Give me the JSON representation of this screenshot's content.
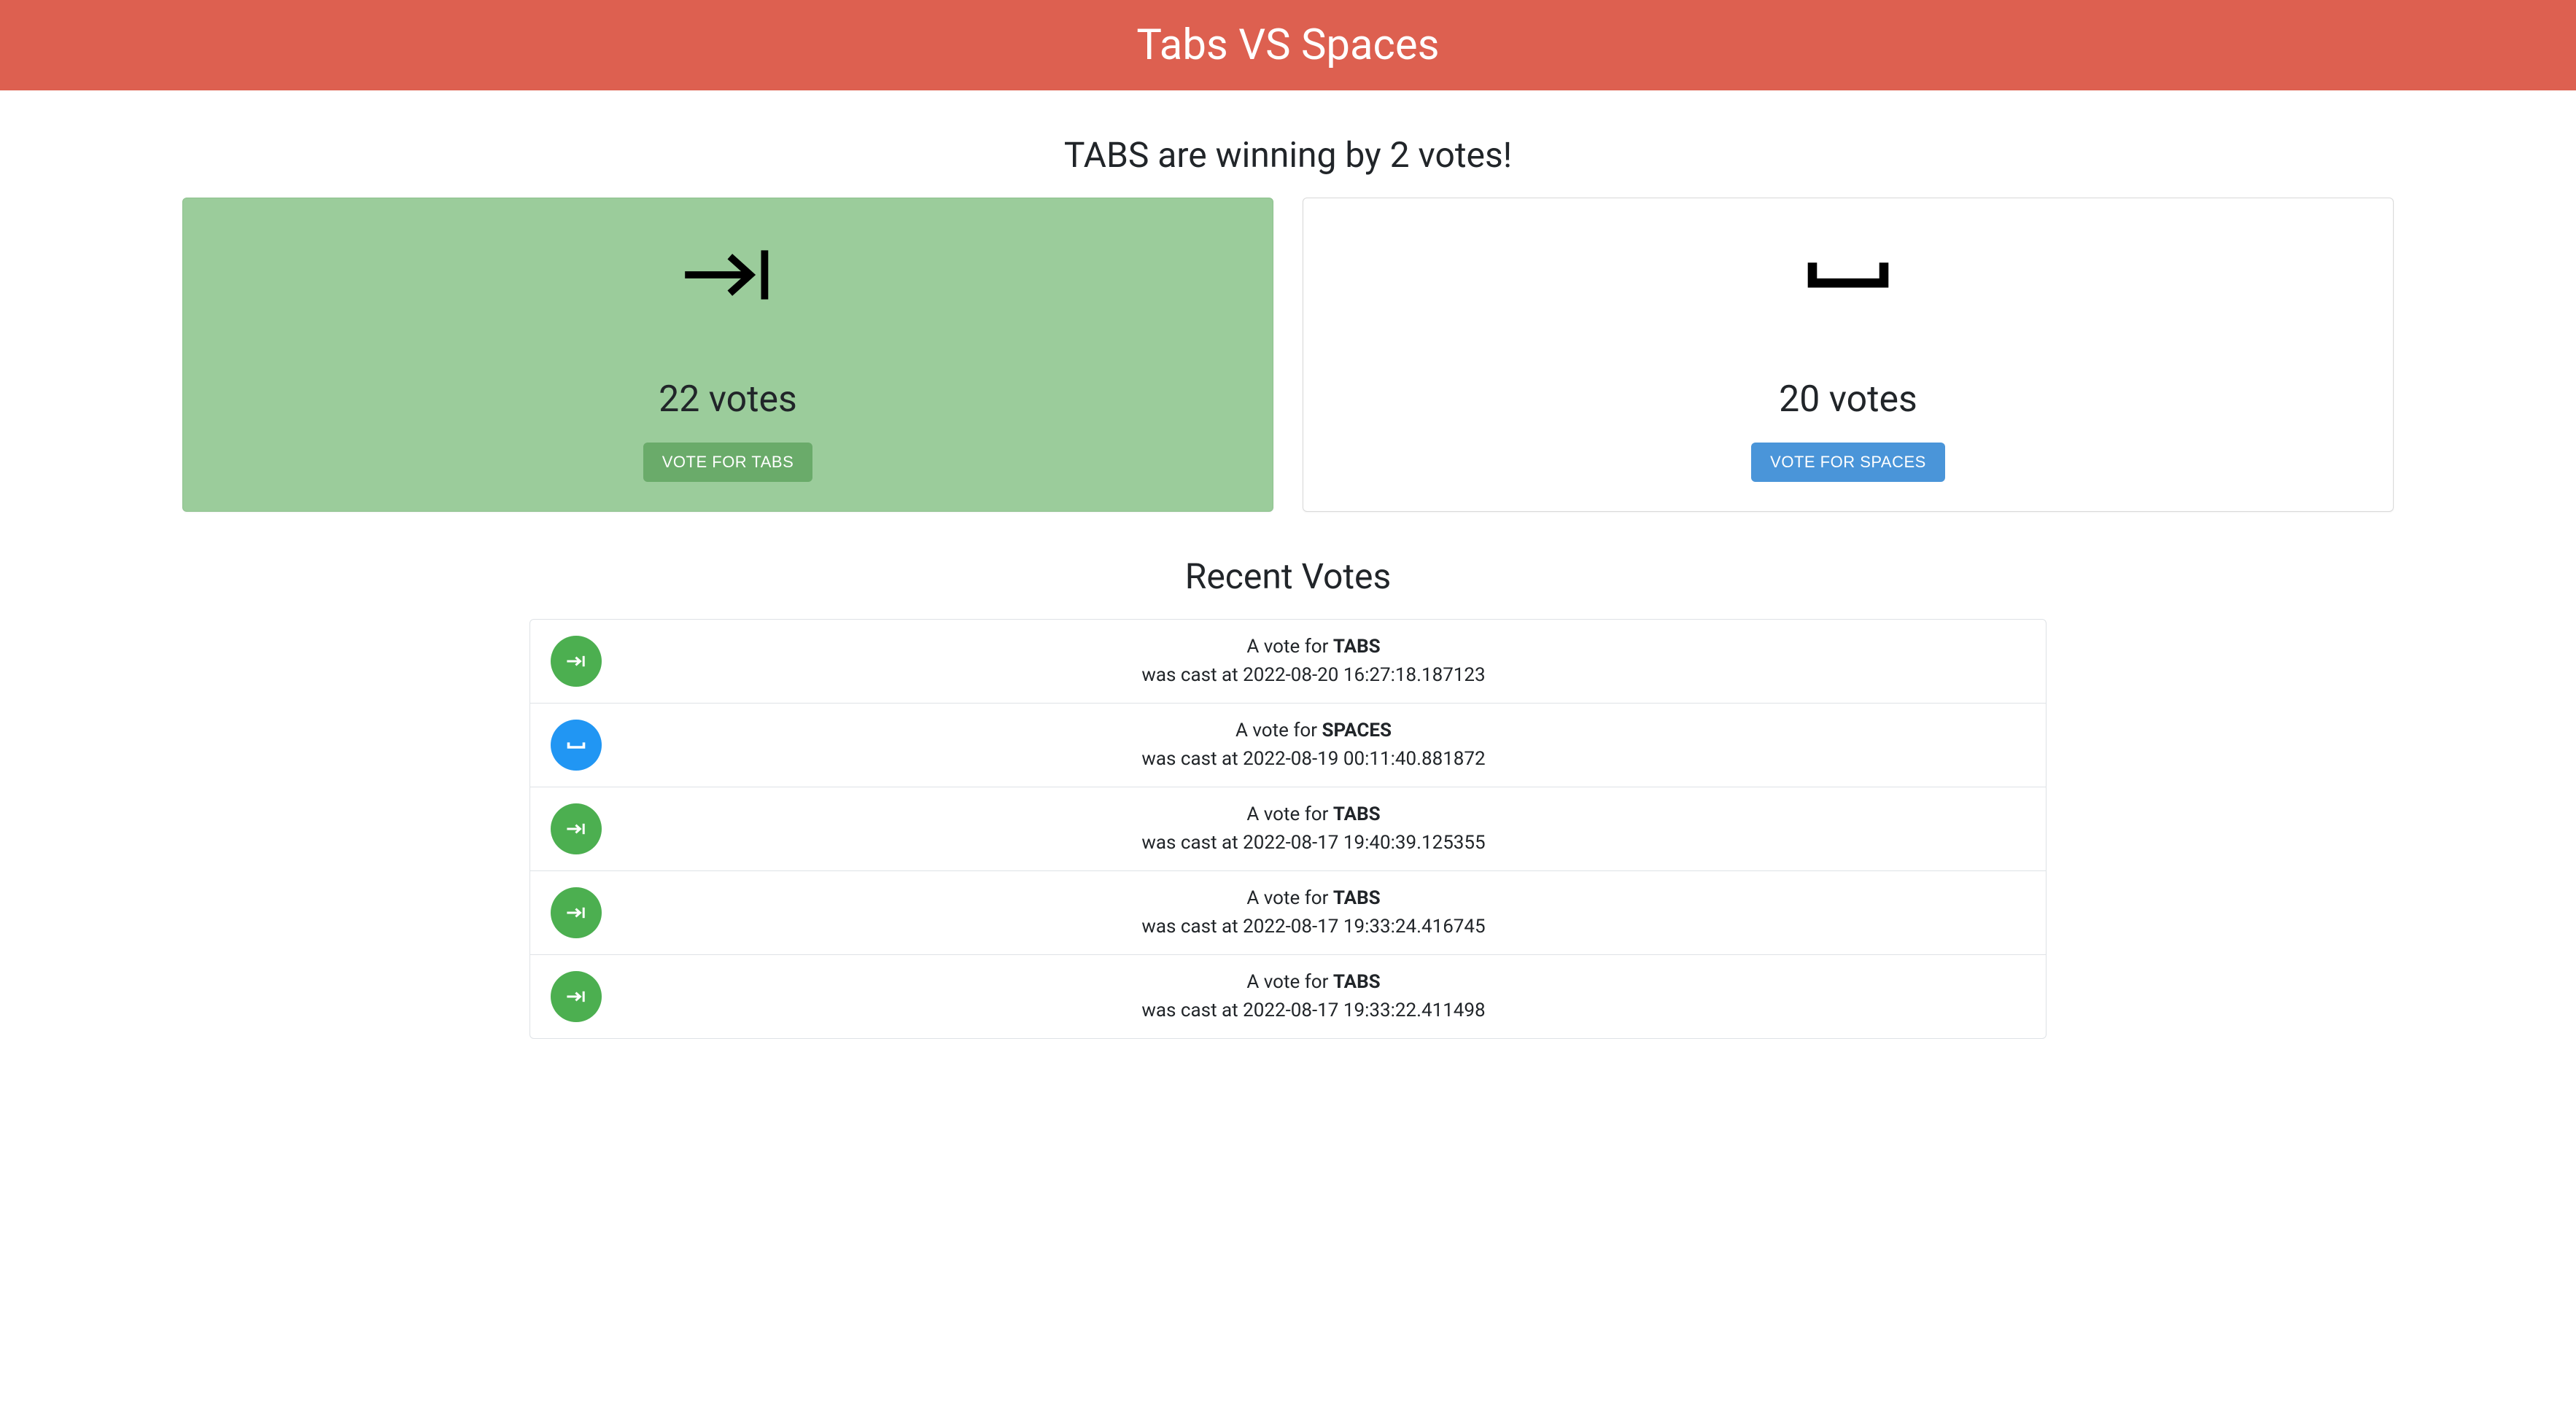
{
  "header": {
    "title": "Tabs VS Spaces"
  },
  "subtitle": "TABS are winning by 2 votes!",
  "tabs_card": {
    "votes_label": "22 votes",
    "button_label": "VOTE FOR TABS"
  },
  "spaces_card": {
    "votes_label": "20 votes",
    "button_label": "VOTE FOR SPACES"
  },
  "recent": {
    "title": "Recent Votes",
    "vote_prefix": "A vote for ",
    "cast_prefix": "was cast at ",
    "items": [
      {
        "type": "TABS",
        "timestamp": "2022-08-20 16:27:18.187123"
      },
      {
        "type": "SPACES",
        "timestamp": "2022-08-19 00:11:40.881872"
      },
      {
        "type": "TABS",
        "timestamp": "2022-08-17 19:40:39.125355"
      },
      {
        "type": "TABS",
        "timestamp": "2022-08-17 19:33:24.416745"
      },
      {
        "type": "TABS",
        "timestamp": "2022-08-17 19:33:22.411498"
      }
    ]
  }
}
